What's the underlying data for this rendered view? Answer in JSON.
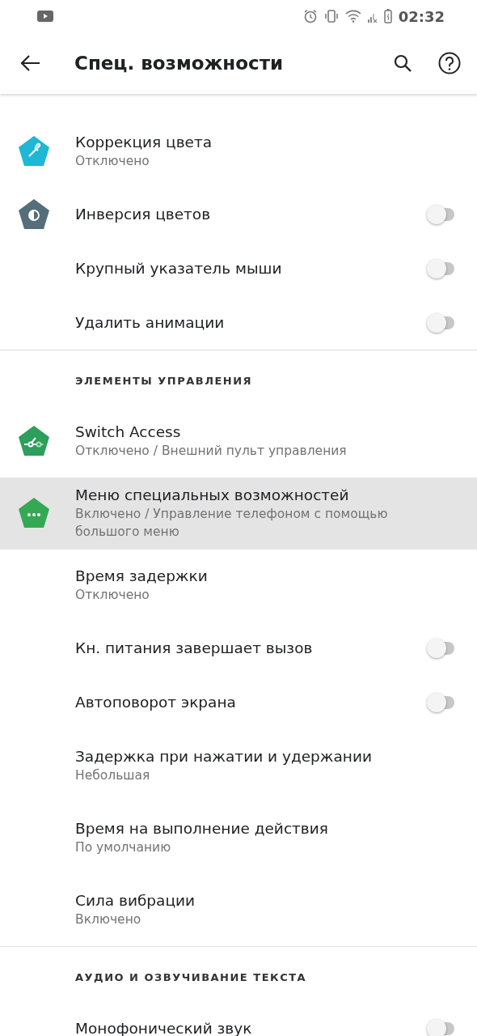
{
  "status_bar": {
    "time": "02:32"
  },
  "app_bar": {
    "title": "Спец. возможности"
  },
  "rows": [
    {
      "kind": "item",
      "title": "Коррекция цвета",
      "subtitle": "Отключено",
      "color": "#1eb7d4",
      "selected": false
    },
    {
      "kind": "item",
      "title": "Инверсия цветов",
      "color": "#546e7a",
      "on": false,
      "selected": false
    },
    {
      "kind": "item",
      "title": "Крупный указатель мыши",
      "on": false,
      "selected": false
    },
    {
      "kind": "item",
      "title": "Удалить анимации",
      "on": false,
      "selected": false
    },
    {
      "kind": "header",
      "title": "ЭЛЕМЕНТЫ УПРАВЛЕНИЯ"
    },
    {
      "kind": "item",
      "title": "Switch Access",
      "subtitle": "Отключено / Внешний пульт управления",
      "color": "#2e9e5b",
      "selected": false
    },
    {
      "kind": "item",
      "title": "Меню специальных возможностей",
      "subtitle": "Включено / Управление телефоном с помощью большого меню",
      "color": "#34a853",
      "selected": true
    },
    {
      "kind": "item",
      "title": "Время задержки",
      "subtitle": "Отключено",
      "selected": false
    },
    {
      "kind": "item",
      "title": "Кн. питания завершает вызов",
      "on": false,
      "selected": false
    },
    {
      "kind": "item",
      "title": "Автоповорот экрана",
      "on": false,
      "selected": false
    },
    {
      "kind": "item",
      "title": "Задержка при нажатии и удержании",
      "subtitle": "Небольшая",
      "selected": false
    },
    {
      "kind": "item",
      "title": "Время на выполнение действия",
      "subtitle": "По умолчанию",
      "selected": false
    },
    {
      "kind": "item",
      "title": "Сила вибрации",
      "subtitle": "Включено",
      "selected": false
    },
    {
      "kind": "header",
      "title": "АУДИО И ОЗВУЧИВАНИЕ ТЕКСТА"
    },
    {
      "kind": "item",
      "title": "Монофонический звук",
      "on": false,
      "selected": false
    }
  ]
}
